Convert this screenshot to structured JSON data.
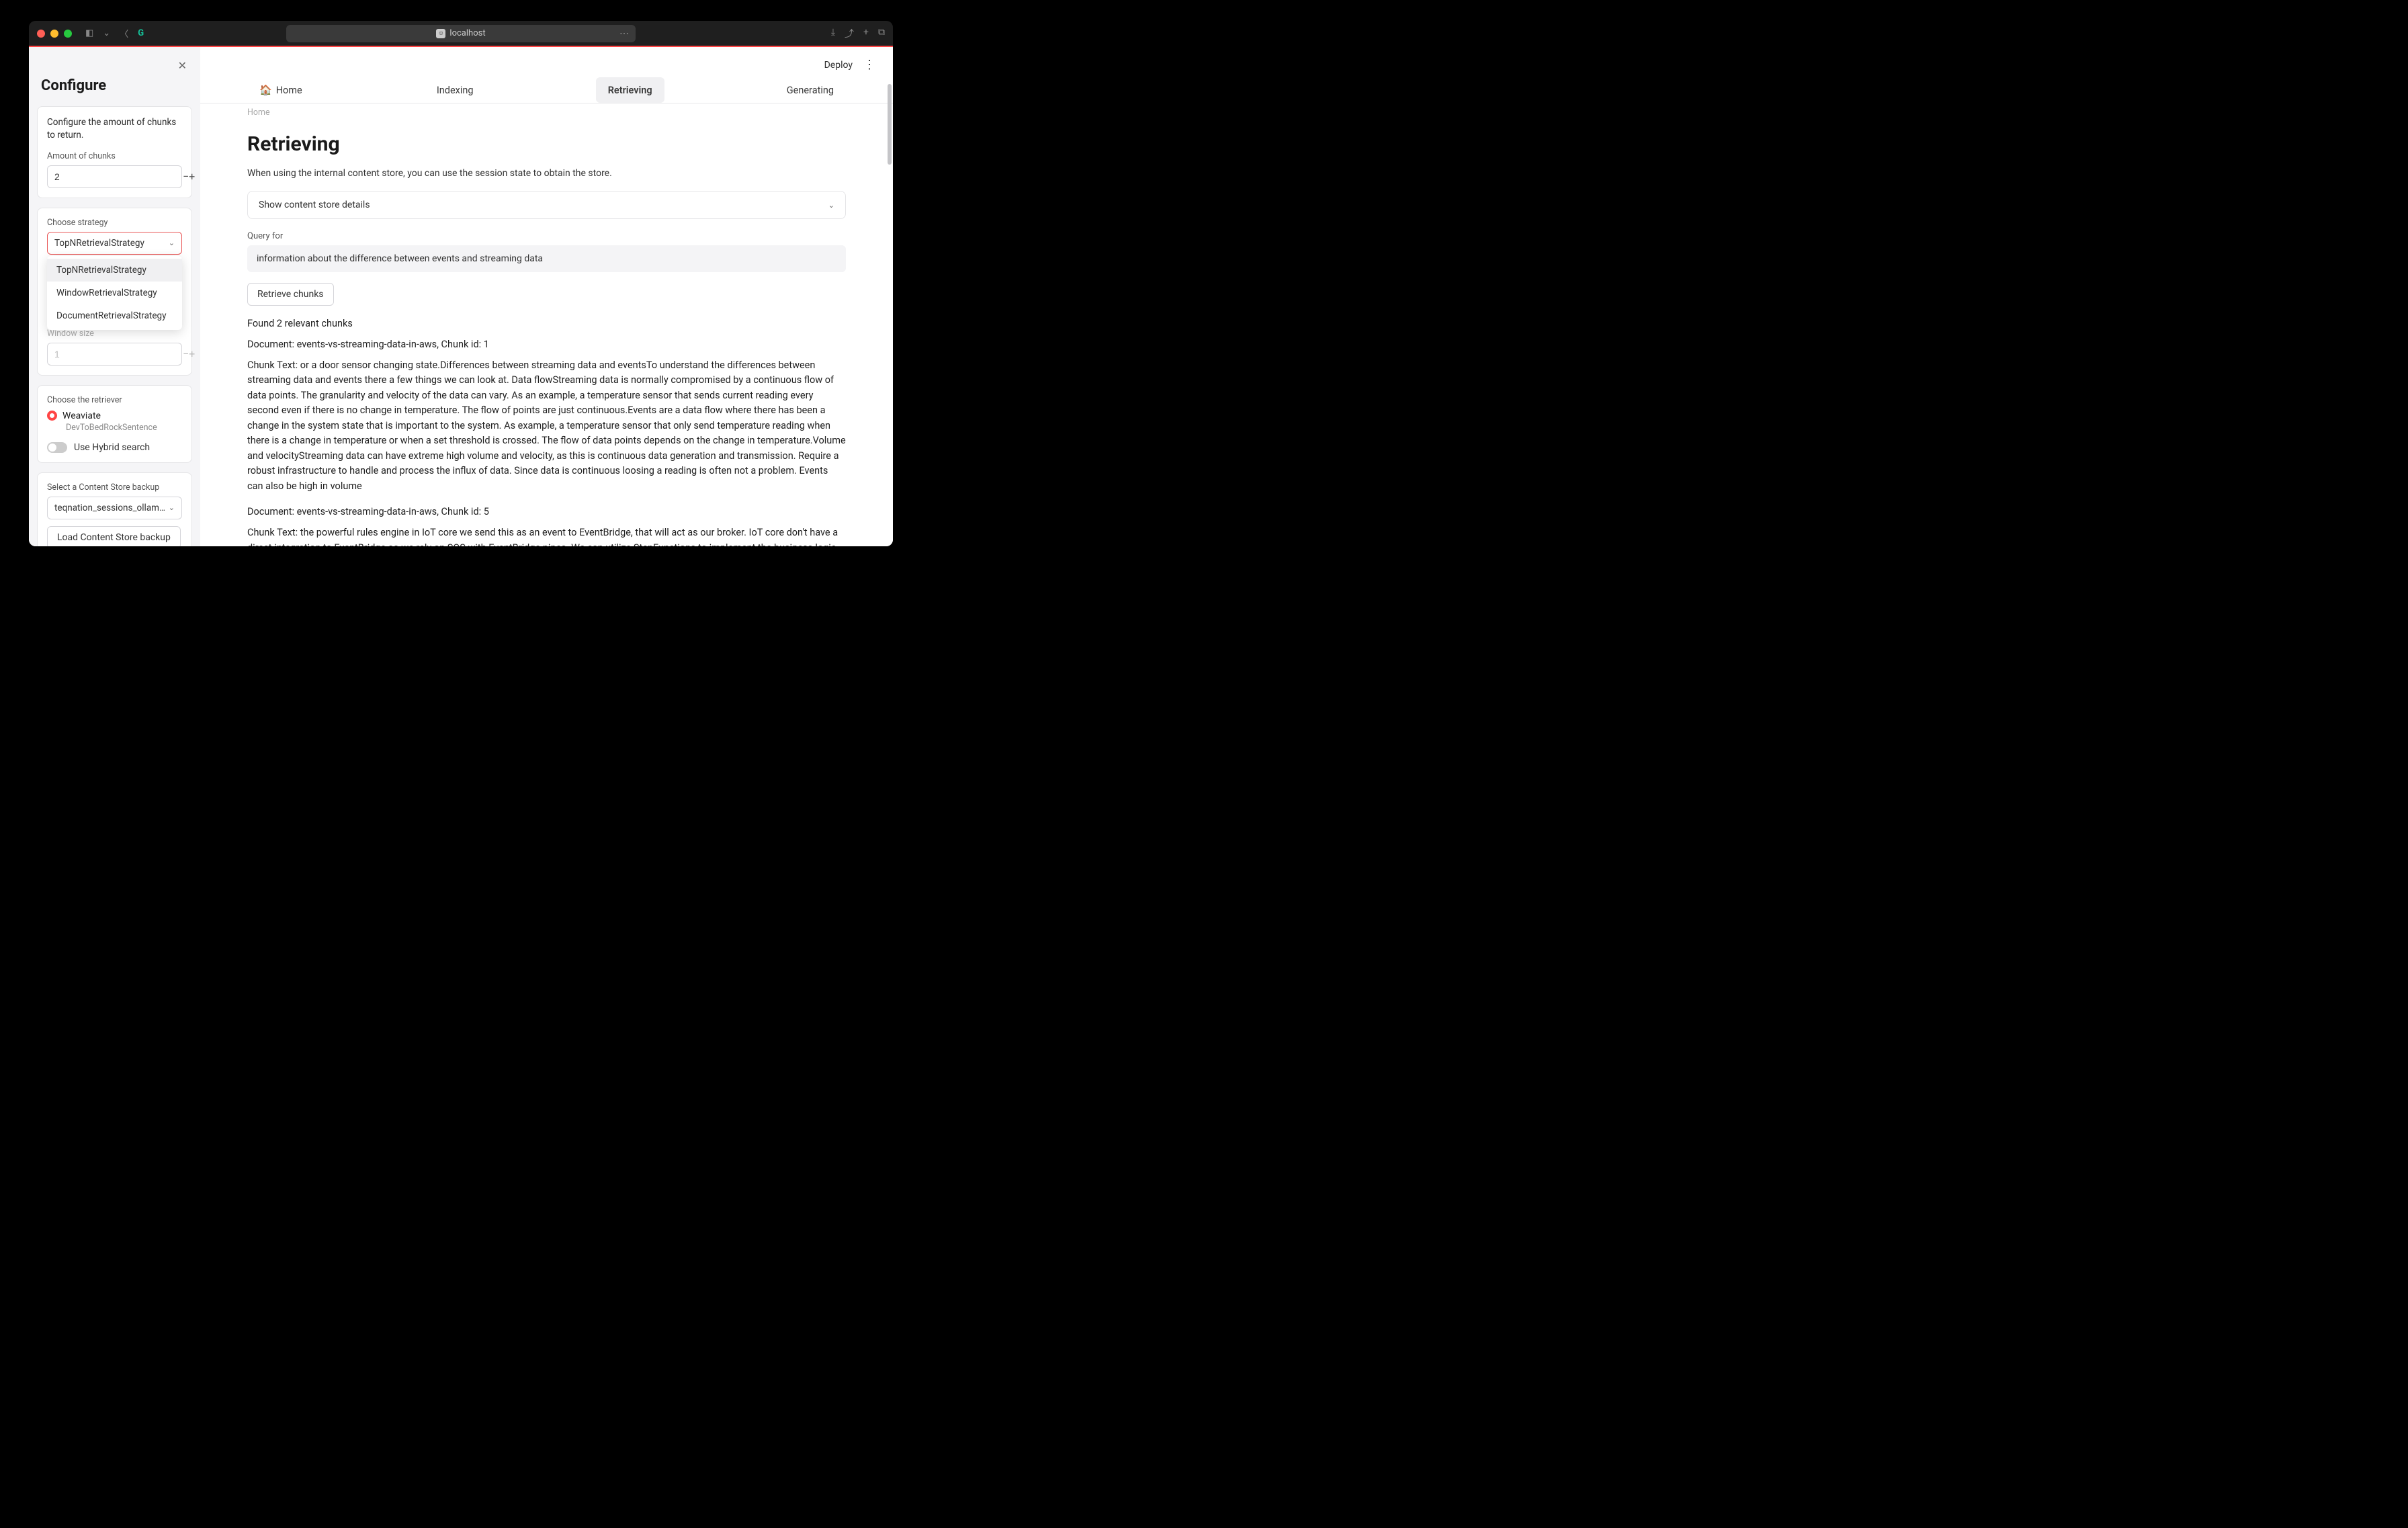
{
  "browser": {
    "url_label": "localhost"
  },
  "header": {
    "deploy": "Deploy"
  },
  "tabs": {
    "home": "Home",
    "indexing": "Indexing",
    "retrieving": "Retrieving",
    "generating": "Generating"
  },
  "breadcrumb": "Home",
  "sidebar": {
    "title": "Configure",
    "chunks_card": {
      "desc": "Configure the amount of chunks to return.",
      "label": "Amount of chunks",
      "value": "2"
    },
    "strategy_card": {
      "label": "Choose strategy",
      "value": "TopNRetrievalStrategy",
      "options": [
        "TopNRetrievalStrategy",
        "WindowRetrievalStrategy",
        "DocumentRetrievalStrategy"
      ],
      "window_label": "Window size",
      "window_value": "1"
    },
    "retriever_card": {
      "label": "Choose the retriever",
      "option": "Weaviate",
      "sub": "DevToBedRockSentence",
      "toggle_label": "Use Hybrid search"
    },
    "backup_card": {
      "label": "Select a Content Store backup",
      "value": "teqnation_sessions_ollam…",
      "button": "Load Content Store backup"
    }
  },
  "page": {
    "title": "Retrieving",
    "desc": "When using the internal content store, you can use the session state to obtain the store.",
    "expander": "Show content store details",
    "query_label": "Query for",
    "query_value": "information about the difference between events and streaming data",
    "retrieve_btn": "Retrieve chunks",
    "found": "Found 2 relevant chunks",
    "doc1": "Document: events-vs-streaming-data-in-aws, Chunk id: 1",
    "chunk1": "Chunk Text: or a door sensor changing state.Differences between streaming data and eventsTo understand the differences between streaming data and events there a few things we can look at. Data flowStreaming data is normally compromised by a continuous flow of data points. The granularity and velocity of the data can vary. As an example, a temperature sensor that sends current reading every second even if there is no change in temperature. The flow of points are just continuous.Events are a data flow where there has been a change in the system state that is important to the system. As example, a temperature sensor that only send temperature reading when there is a change in temperature or when a set threshold is crossed. The flow of data points depends on the change in temperature.Volume and velocityStreaming data can have extreme high volume and velocity, as this is continuous data generation and transmission. Require a robust infrastructure to handle and process the influx of data. Since data is continuous loosing a reading is often not a problem. Events can also be high in volume",
    "doc2": "Document: events-vs-streaming-data-in-aws, Chunk id: 5",
    "chunk2": "Chunk Text: the powerful rules engine in IoT core we send this as an event to EventBridge, that will act as our broker. IoT core don't have a direct integration to EventBridge so we rely on SQS with EventBridge pipes. We can utilize StepFunctions to implement the business logic and then send the action back through IoT core.ConclusionIn conclusion, while streaming data and events are distinct concepts, they share similarities and can often intersect. Streaming data represents continuous flows of information, whereas events are changes in state. Understanding the nuances between the two is crucial for designing systems that leverage real-time insights and enable timely actions. Almost all the time events can be seen as streaming data, while streaming data most often is not events. Final WordsThis was a post looking the the differences and similarities between streaming data and events. Streaming data is not always events, while events often can be treated as streaming data. Check outMy serverless Handbookfor some of the concepts mentioned in this post. Don't forget to follow"
  }
}
